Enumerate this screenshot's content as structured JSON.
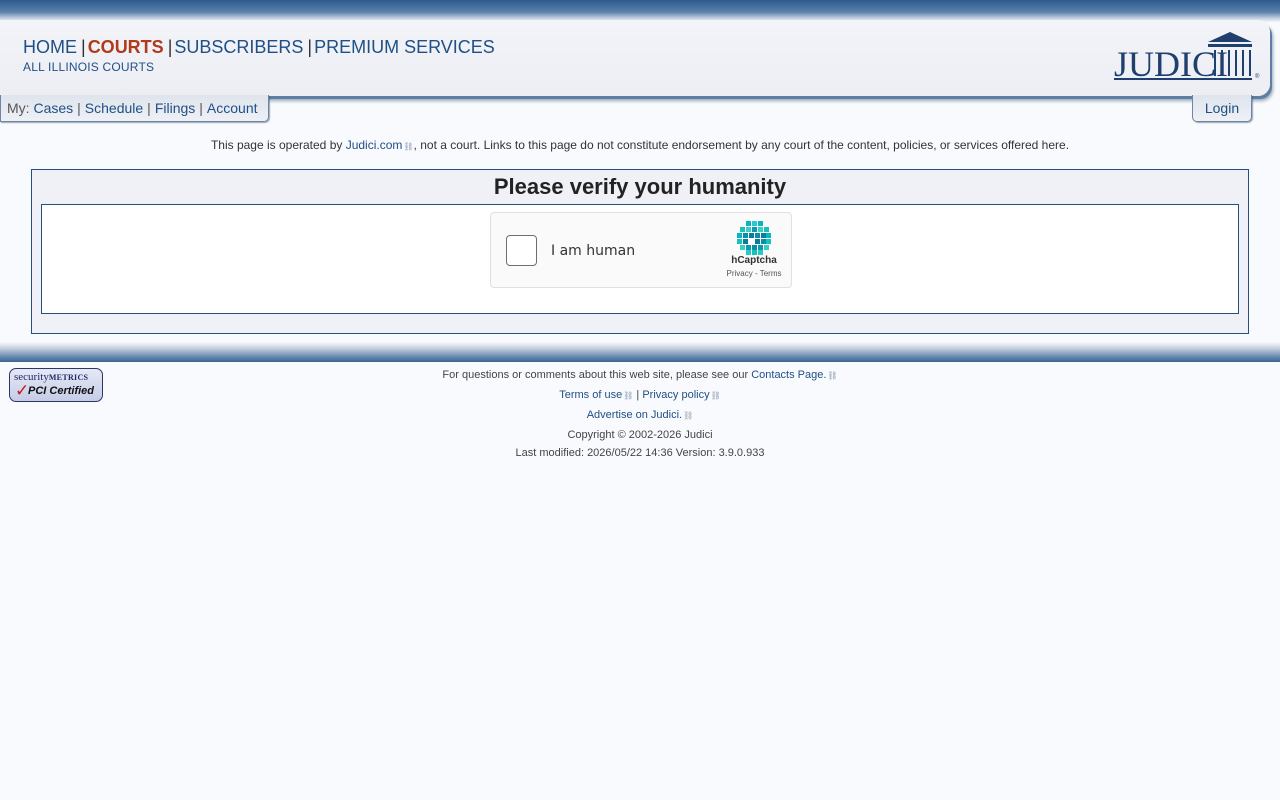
{
  "header": {
    "nav": [
      {
        "label": "HOME",
        "active": false
      },
      {
        "label": "COURTS",
        "active": true
      },
      {
        "label": "SUBSCRIBERS",
        "active": false
      },
      {
        "label": "PREMIUM SERVICES",
        "active": false
      }
    ],
    "subnav": "ALL ILLINOIS COURTS",
    "logo_text": "JUDICI"
  },
  "my_tab": {
    "prefix": "My:",
    "items": [
      "Cases",
      "Schedule",
      "Filings",
      "Account"
    ]
  },
  "login_label": "Login",
  "disclaimer": {
    "before": "This page is operated by ",
    "link": "Judici.com",
    "after": ", not a court. Links to this page do not constitute endorsement by any court of the content, policies, or services offered here."
  },
  "verify": {
    "title": "Please verify your humanity",
    "captcha": {
      "label": "I am human",
      "brand": "hCaptcha",
      "privacy": "Privacy",
      "dash": " - ",
      "terms": "Terms"
    }
  },
  "badge": {
    "security": "security",
    "metrics": "METRICS",
    "certified": "PCI Certified"
  },
  "footer": {
    "contact_before": "For questions or comments about this web site, please see our ",
    "contact_link": "Contacts Page.",
    "terms": "Terms of use",
    "separator": "|",
    "privacy": "Privacy policy",
    "advertise": "Advertise on Judici.",
    "copyright": "Copyright © 2002-2026 Judici",
    "modified": "Last modified: 2026/05/22 14:36 Version: 3.9.0.933"
  },
  "colors": {
    "primary_blue": "#1f4f86",
    "active_nav": "#b03a1a",
    "border_blue": "#254f7f"
  }
}
